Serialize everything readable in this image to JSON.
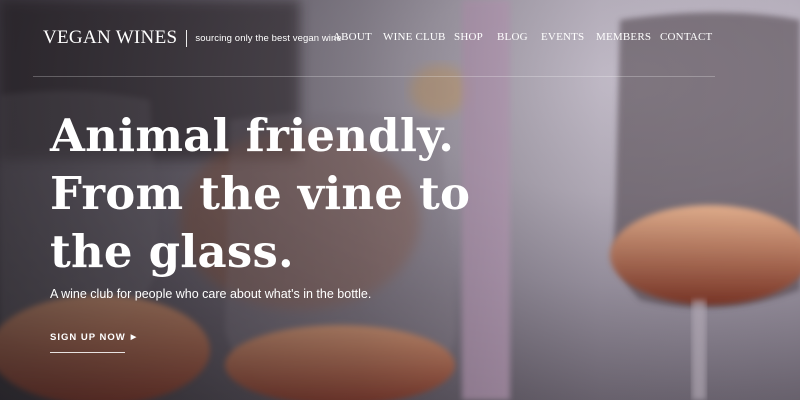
{
  "brand": {
    "name": "VEGAN WINES",
    "tagline": "sourcing only the best vegan wine"
  },
  "nav": {
    "items": [
      "ABOUT",
      "WINE CLUB",
      "SHOP",
      "BLOG",
      "EVENTS",
      "MEMBERS",
      "CONTACT"
    ]
  },
  "hero": {
    "title_lines": [
      "Animal friendly.",
      "From the vine to",
      "the glass."
    ],
    "subtitle": "A wine club for people who care about what's in the bottle.",
    "cta_label": "SIGN UP NOW",
    "cta_icon": "triangle-right-icon"
  },
  "colors": {
    "text": "#ffffff",
    "wine": "#c8745a"
  },
  "background": {
    "image": "blurred photo of rosé wine glasses and a candle"
  }
}
